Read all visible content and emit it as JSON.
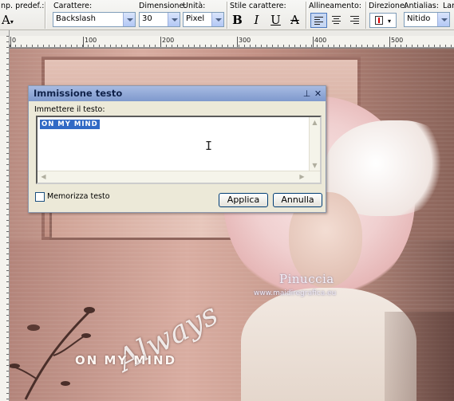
{
  "toolbar": {
    "preset_label": "np. predef.:",
    "preset_icon": "text-tool-icon",
    "font_label": "Carattere:",
    "font_value": "Backslash",
    "size_label": "Dimensione:",
    "size_value": "30",
    "units_label": "Unità:",
    "units_value": "Pixel",
    "style_label": "Stile carattere:",
    "bold": "B",
    "italic": "I",
    "underline": "U",
    "strike": "A",
    "align_label": "Allineamento:",
    "direction_label": "Direzione:",
    "antialias_label": "Antialias:",
    "antialias_value": "Nitido",
    "cut_label": "Lar",
    "selected_color": "#316ac5"
  },
  "ruler": {
    "marks": [
      "0",
      "100",
      "200",
      "300",
      "400",
      "500"
    ]
  },
  "canvas": {
    "watermark_name": "Pinuccia",
    "watermark_url": "www.maidiregrafica.eu",
    "art_script": "Always",
    "art_caption": "ON MY MIND"
  },
  "dialog": {
    "title": "Immissione testo",
    "pin_icon": "pin-icon",
    "close_icon": "close-icon",
    "prompt": "Immettere il testo:",
    "text_value": "ON MY MIND",
    "remember_label": "Memorizza testo",
    "apply_label": "Applica",
    "cancel_label": "Annulla"
  }
}
